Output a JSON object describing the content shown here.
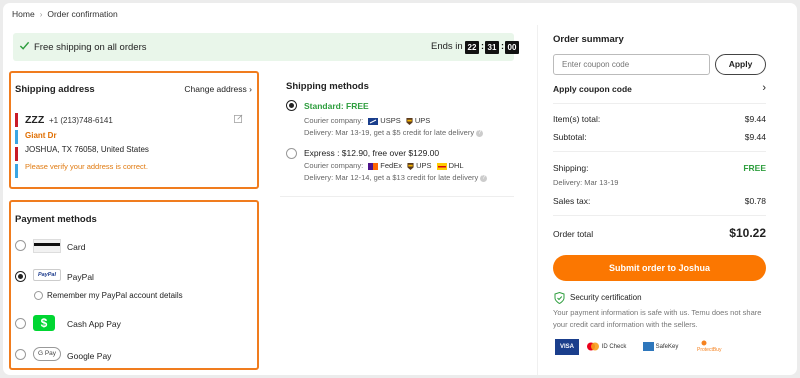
{
  "breadcrumb": {
    "home": "Home",
    "sep": "›",
    "current": "Order confirmation"
  },
  "banner": {
    "text": "Free shipping on all orders",
    "ends_label": "Ends in",
    "timer": {
      "h": "22",
      "m": "31",
      "s": "00"
    },
    "accent": "#2e9e3e"
  },
  "shipping_address": {
    "title": "Shipping address",
    "change_label": "Change address",
    "name": "ZZZ",
    "phone": "+1 (213)748-6141",
    "street": "Giant Dr",
    "city": "JOSHUA, TX 76058, United States",
    "warning": "Please verify your address is correct."
  },
  "payment": {
    "title": "Payment methods",
    "methods": [
      {
        "label": "Card",
        "selected": false
      },
      {
        "label": "PayPal",
        "selected": true,
        "logo_text": "PayPal"
      },
      {
        "label": "Cash App Pay",
        "selected": false,
        "logo_text": "$"
      },
      {
        "label": "Google Pay",
        "selected": false,
        "logo_text": "G Pay"
      }
    ],
    "remember_paypal": "Remember my PayPal account details"
  },
  "shipping_methods": {
    "title": "Shipping methods",
    "options": [
      {
        "title": "Standard: FREE",
        "selected": true,
        "courier_label": "Courier company:",
        "couriers": [
          "USPS",
          "UPS"
        ],
        "delivery": "Delivery: Mar 13-19, get a $5 credit for late delivery"
      },
      {
        "title": "Express : $12.90, free over $129.00",
        "selected": false,
        "courier_label": "Courier company:",
        "couriers": [
          "FedEx",
          "UPS",
          "DHL"
        ],
        "delivery": "Delivery: Mar 12-14, get a $13 credit for late delivery"
      }
    ]
  },
  "summary": {
    "title": "Order summary",
    "coupon_placeholder": "Enter coupon code",
    "apply_label": "Apply",
    "apply_coupon_label": "Apply coupon code",
    "items_label": "Item(s) total:",
    "items_value": "$9.44",
    "subtotal_label": "Subtotal:",
    "subtotal_value": "$9.44",
    "shipping_label": "Shipping:",
    "shipping_value": "FREE",
    "shipping_delivery": "Delivery: Mar 13-19",
    "tax_label": "Sales tax:",
    "tax_value": "$0.78",
    "total_label": "Order total",
    "total_value": "$10.22",
    "submit_label": "Submit order to Joshua",
    "security_title": "Security certification",
    "security_text": "Your payment information is safe with us. Temu does not share your credit card information with the sellers.",
    "badges": [
      "VISA",
      "ID Check",
      "SafeKey",
      "ProtectBuy"
    ],
    "brand_color": "#fb7701"
  }
}
